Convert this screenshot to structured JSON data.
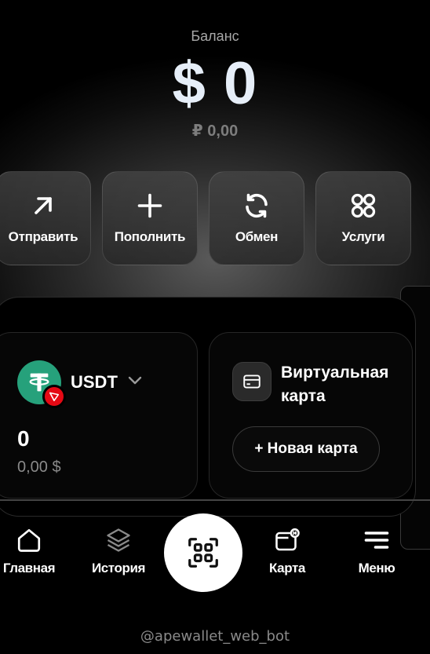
{
  "balance": {
    "label": "Баланс",
    "amount": "$ 0",
    "fiat": "₽ 0,00"
  },
  "actions": [
    {
      "label": "Отправить",
      "icon": "arrow-up-right-icon"
    },
    {
      "label": "Пополнить",
      "icon": "plus-icon"
    },
    {
      "label": "Обмен",
      "icon": "refresh-icon"
    },
    {
      "label": "Услуги",
      "icon": "grid-circles-icon"
    }
  ],
  "asset": {
    "name": "USDT",
    "amount": "0",
    "usd_value": "0,00 $",
    "icon": "tether-icon",
    "network_icon": "tron-icon",
    "coin_color": "#26a17b",
    "network_color": "#e50914"
  },
  "virtual_card": {
    "title": "Виртуальная\nкарта",
    "new_card_label": "+ Новая карта",
    "icon": "card-icon"
  },
  "nav": {
    "home": "Главная",
    "history": "История",
    "card": "Карта",
    "menu": "Меню",
    "scan_icon": "qr-scan-icon"
  },
  "footer": {
    "bot": "@apewallet_web_bot"
  }
}
